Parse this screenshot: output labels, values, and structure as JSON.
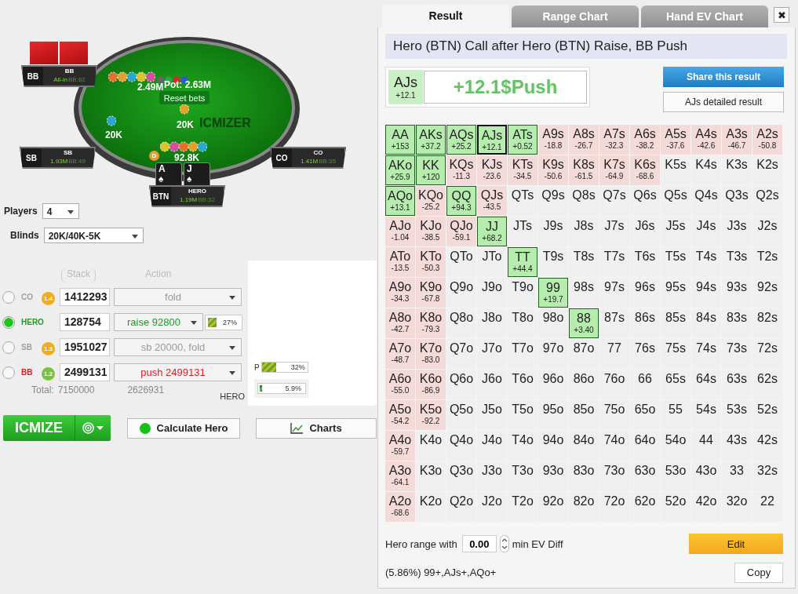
{
  "table": {
    "logo": "ICMIZER",
    "pot": "Pot: 2.63M",
    "reset": "Reset bets",
    "dealer": "D",
    "bets": [
      {
        "amount": "2.49M"
      },
      {
        "amount": "20K"
      },
      {
        "amount": "20K"
      },
      {
        "amount": "92.8K"
      }
    ],
    "seats": [
      {
        "position": "BB",
        "name": "BB",
        "stack": "All-in",
        "bb": "BB:62",
        "cards": [
          {
            "kind": "back"
          },
          {
            "kind": "back"
          }
        ]
      },
      {
        "position": "SB",
        "name": "SB",
        "stack": "1.93M",
        "bb": "BB:49"
      },
      {
        "position": "CO",
        "name": "CO",
        "stack": "1.41M",
        "bb": "BB:35"
      },
      {
        "position": "BTN",
        "name": "HERO",
        "stack": "1.19M",
        "bb": "BB:32",
        "cards": [
          {
            "kind": "face",
            "rank": "A",
            "suit": "♠"
          },
          {
            "kind": "face",
            "rank": "J",
            "suit": "♠"
          }
        ]
      }
    ]
  },
  "setup": {
    "players_label": "Players",
    "players": "4",
    "blinds_label": "Blinds",
    "blinds": "20K/40K-5K"
  },
  "players": {
    "stack_header": "Stack",
    "action_header": "Action",
    "rows": [
      {
        "position": "CO",
        "selected": false,
        "badge": "1.4",
        "color": "#f0ac1c",
        "stack": "1412293",
        "action": "fold",
        "kind": "fold"
      },
      {
        "position": "HERO",
        "selected": true,
        "stack": "128754",
        "action": "raise 92800",
        "kind": "raise",
        "range": {
          "level": 0.27,
          "reading": "27%"
        }
      },
      {
        "position": "SB",
        "selected": false,
        "badge": "1.3",
        "color": "#f0ac1c",
        "stack": "1951027",
        "action": "sb 20000, fold",
        "kind": "fold"
      },
      {
        "position": "BB",
        "selected": false,
        "badge": "1.2",
        "color": "#7cc242",
        "stack": "2499131",
        "action": "push 2499131",
        "kind": "push"
      }
    ],
    "total_label": "Total:",
    "total_stack": "7150000",
    "total_action": "2626931",
    "hero_label": "HERO",
    "p_label": "P",
    "p_bar": {
      "level": 0.32,
      "reading": "32%"
    },
    "hero_bar": {
      "level": 0.059,
      "reading": "5.9%"
    }
  },
  "buttons": {
    "icmize": "ICMIZE",
    "calculate": "Calculate Hero",
    "charts": "Charts"
  },
  "popup": {
    "tabs": [
      {
        "label": "Result",
        "selected": true
      },
      {
        "label": "Range Chart",
        "selected": false
      },
      {
        "label": "Hand EV Chart",
        "selected": false
      }
    ],
    "close": "✖",
    "title": "Hero (BTN) Call after Hero (BTN) Raise, BB Push",
    "hand": "AJs",
    "hand_ev": "+12.1",
    "result": "+12.1$Push",
    "share": "Share this result",
    "detail": "AJs detailed result",
    "grid": [
      [
        {
          "hand": "AA",
          "ev": "+153",
          "kind": "plus",
          "selected": false
        },
        {
          "hand": "AKs",
          "ev": "+37.2",
          "kind": "plus",
          "selected": false
        },
        {
          "hand": "AQs",
          "ev": "+25.2",
          "kind": "plus",
          "selected": false
        },
        {
          "hand": "AJs",
          "ev": "+12.1",
          "kind": "plus",
          "selected": true
        },
        {
          "hand": "ATs",
          "ev": "+0.52",
          "kind": "plus",
          "selected": false
        },
        {
          "hand": "A9s",
          "ev": "-18.8",
          "kind": "minus",
          "selected": false
        },
        {
          "hand": "A8s",
          "ev": "-26.7",
          "kind": "minus",
          "selected": false
        },
        {
          "hand": "A7s",
          "ev": "-32.3",
          "kind": "minus",
          "selected": false
        },
        {
          "hand": "A6s",
          "ev": "-38.2",
          "kind": "minus",
          "selected": false
        },
        {
          "hand": "A5s",
          "ev": "-37.6",
          "kind": "minus",
          "selected": false
        },
        {
          "hand": "A4s",
          "ev": "-42.6",
          "kind": "minus",
          "selected": false
        },
        {
          "hand": "A3s",
          "ev": "-46.7",
          "kind": "minus",
          "selected": false
        },
        {
          "hand": "A2s",
          "ev": "-50.8",
          "kind": "minus",
          "selected": false
        }
      ],
      [
        {
          "hand": "AKo",
          "ev": "+25.9",
          "kind": "plus",
          "selected": false
        },
        {
          "hand": "KK",
          "ev": "+120",
          "kind": "plus",
          "selected": false
        },
        {
          "hand": "KQs",
          "ev": "-11.3",
          "kind": "minus",
          "selected": false
        },
        {
          "hand": "KJs",
          "ev": "-23.6",
          "kind": "minus",
          "selected": false
        },
        {
          "hand": "KTs",
          "ev": "-34.5",
          "kind": "minus",
          "selected": false
        },
        {
          "hand": "K9s",
          "ev": "-50.6",
          "kind": "minus",
          "selected": false
        },
        {
          "hand": "K8s",
          "ev": "-61.5",
          "kind": "minus",
          "selected": false
        },
        {
          "hand": "K7s",
          "ev": "-64.9",
          "kind": "minus",
          "selected": false
        },
        {
          "hand": "K6s",
          "ev": "-68.6",
          "kind": "minus",
          "selected": false
        },
        {
          "hand": "K5s",
          "kind": "plain",
          "selected": false
        },
        {
          "hand": "K4s",
          "kind": "plain",
          "selected": false
        },
        {
          "hand": "K3s",
          "kind": "plain",
          "selected": false
        },
        {
          "hand": "K2s",
          "kind": "plain",
          "selected": false
        }
      ],
      [
        {
          "hand": "AQo",
          "ev": "+13.1",
          "kind": "plus",
          "selected": false
        },
        {
          "hand": "KQo",
          "ev": "-25.2",
          "kind": "minus",
          "selected": false
        },
        {
          "hand": "QQ",
          "ev": "+94.3",
          "kind": "plus",
          "selected": false
        },
        {
          "hand": "QJs",
          "ev": "-43.5",
          "kind": "minus",
          "selected": false
        },
        {
          "hand": "QTs",
          "kind": "plain",
          "selected": false
        },
        {
          "hand": "Q9s",
          "kind": "plain",
          "selected": false
        },
        {
          "hand": "Q8s",
          "kind": "plain",
          "selected": false
        },
        {
          "hand": "Q7s",
          "kind": "plain",
          "selected": false
        },
        {
          "hand": "Q6s",
          "kind": "plain",
          "selected": false
        },
        {
          "hand": "Q5s",
          "kind": "plain",
          "selected": false
        },
        {
          "hand": "Q4s",
          "kind": "plain",
          "selected": false
        },
        {
          "hand": "Q3s",
          "kind": "plain",
          "selected": false
        },
        {
          "hand": "Q2s",
          "kind": "plain",
          "selected": false
        }
      ],
      [
        {
          "hand": "AJo",
          "ev": "-1.04",
          "kind": "minus",
          "selected": false
        },
        {
          "hand": "KJo",
          "ev": "-38.5",
          "kind": "minus",
          "selected": false
        },
        {
          "hand": "QJo",
          "ev": "-59.1",
          "kind": "minus",
          "selected": false
        },
        {
          "hand": "JJ",
          "ev": "+68.2",
          "kind": "plus",
          "selected": false
        },
        {
          "hand": "JTs",
          "kind": "plain",
          "selected": false
        },
        {
          "hand": "J9s",
          "kind": "plain",
          "selected": false
        },
        {
          "hand": "J8s",
          "kind": "plain",
          "selected": false
        },
        {
          "hand": "J7s",
          "kind": "plain",
          "selected": false
        },
        {
          "hand": "J6s",
          "kind": "plain",
          "selected": false
        },
        {
          "hand": "J5s",
          "kind": "plain",
          "selected": false
        },
        {
          "hand": "J4s",
          "kind": "plain",
          "selected": false
        },
        {
          "hand": "J3s",
          "kind": "plain",
          "selected": false
        },
        {
          "hand": "J2s",
          "kind": "plain",
          "selected": false
        }
      ],
      [
        {
          "hand": "ATo",
          "ev": "-13.5",
          "kind": "minus",
          "selected": false
        },
        {
          "hand": "KTo",
          "ev": "-50.3",
          "kind": "minus",
          "selected": false
        },
        {
          "hand": "QTo",
          "kind": "plain",
          "selected": false
        },
        {
          "hand": "JTo",
          "kind": "plain",
          "selected": false
        },
        {
          "hand": "TT",
          "ev": "+44.4",
          "kind": "plus",
          "selected": false
        },
        {
          "hand": "T9s",
          "kind": "plain",
          "selected": false
        },
        {
          "hand": "T8s",
          "kind": "plain",
          "selected": false
        },
        {
          "hand": "T7s",
          "kind": "plain",
          "selected": false
        },
        {
          "hand": "T6s",
          "kind": "plain",
          "selected": false
        },
        {
          "hand": "T5s",
          "kind": "plain",
          "selected": false
        },
        {
          "hand": "T4s",
          "kind": "plain",
          "selected": false
        },
        {
          "hand": "T3s",
          "kind": "plain",
          "selected": false
        },
        {
          "hand": "T2s",
          "kind": "plain",
          "selected": false
        }
      ],
      [
        {
          "hand": "A9o",
          "ev": "-34.3",
          "kind": "minus",
          "selected": false
        },
        {
          "hand": "K9o",
          "ev": "-67.8",
          "kind": "minus",
          "selected": false
        },
        {
          "hand": "Q9o",
          "kind": "plain",
          "selected": false
        },
        {
          "hand": "J9o",
          "kind": "plain",
          "selected": false
        },
        {
          "hand": "T9o",
          "kind": "plain",
          "selected": false
        },
        {
          "hand": "99",
          "ev": "+19.7",
          "kind": "plus",
          "selected": false
        },
        {
          "hand": "98s",
          "kind": "plain",
          "selected": false
        },
        {
          "hand": "97s",
          "kind": "plain",
          "selected": false
        },
        {
          "hand": "96s",
          "kind": "plain",
          "selected": false
        },
        {
          "hand": "95s",
          "kind": "plain",
          "selected": false
        },
        {
          "hand": "94s",
          "kind": "plain",
          "selected": false
        },
        {
          "hand": "93s",
          "kind": "plain",
          "selected": false
        },
        {
          "hand": "92s",
          "kind": "plain",
          "selected": false
        }
      ],
      [
        {
          "hand": "A8o",
          "ev": "-42.7",
          "kind": "minus",
          "selected": false
        },
        {
          "hand": "K8o",
          "ev": "-79.3",
          "kind": "minus",
          "selected": false
        },
        {
          "hand": "Q8o",
          "kind": "plain",
          "selected": false
        },
        {
          "hand": "J8o",
          "kind": "plain",
          "selected": false
        },
        {
          "hand": "T8o",
          "kind": "plain",
          "selected": false
        },
        {
          "hand": "98o",
          "kind": "plain",
          "selected": false
        },
        {
          "hand": "88",
          "ev": "+3.40",
          "kind": "plus",
          "selected": false
        },
        {
          "hand": "87s",
          "kind": "plain",
          "selected": false
        },
        {
          "hand": "86s",
          "kind": "plain",
          "selected": false
        },
        {
          "hand": "85s",
          "kind": "plain",
          "selected": false
        },
        {
          "hand": "84s",
          "kind": "plain",
          "selected": false
        },
        {
          "hand": "83s",
          "kind": "plain",
          "selected": false
        },
        {
          "hand": "82s",
          "kind": "plain",
          "selected": false
        }
      ],
      [
        {
          "hand": "A7o",
          "ev": "-48.7",
          "kind": "minus",
          "selected": false
        },
        {
          "hand": "K7o",
          "ev": "-83.0",
          "kind": "minus",
          "selected": false
        },
        {
          "hand": "Q7o",
          "kind": "plain",
          "selected": false
        },
        {
          "hand": "J7o",
          "kind": "plain",
          "selected": false
        },
        {
          "hand": "T7o",
          "kind": "plain",
          "selected": false
        },
        {
          "hand": "97o",
          "kind": "plain",
          "selected": false
        },
        {
          "hand": "87o",
          "kind": "plain",
          "selected": false
        },
        {
          "hand": "77",
          "kind": "plain",
          "selected": false
        },
        {
          "hand": "76s",
          "kind": "plain",
          "selected": false
        },
        {
          "hand": "75s",
          "kind": "plain",
          "selected": false
        },
        {
          "hand": "74s",
          "kind": "plain",
          "selected": false
        },
        {
          "hand": "73s",
          "kind": "plain",
          "selected": false
        },
        {
          "hand": "72s",
          "kind": "plain",
          "selected": false
        }
      ],
      [
        {
          "hand": "A6o",
          "ev": "-55.0",
          "kind": "minus",
          "selected": false
        },
        {
          "hand": "K6o",
          "ev": "-86.9",
          "kind": "minus",
          "selected": false
        },
        {
          "hand": "Q6o",
          "kind": "plain",
          "selected": false
        },
        {
          "hand": "J6o",
          "kind": "plain",
          "selected": false
        },
        {
          "hand": "T6o",
          "kind": "plain",
          "selected": false
        },
        {
          "hand": "96o",
          "kind": "plain",
          "selected": false
        },
        {
          "hand": "86o",
          "kind": "plain",
          "selected": false
        },
        {
          "hand": "76o",
          "kind": "plain",
          "selected": false
        },
        {
          "hand": "66",
          "kind": "plain",
          "selected": false
        },
        {
          "hand": "65s",
          "kind": "plain",
          "selected": false
        },
        {
          "hand": "64s",
          "kind": "plain",
          "selected": false
        },
        {
          "hand": "63s",
          "kind": "plain",
          "selected": false
        },
        {
          "hand": "62s",
          "kind": "plain",
          "selected": false
        }
      ],
      [
        {
          "hand": "A5o",
          "ev": "-54.2",
          "kind": "minus",
          "selected": false
        },
        {
          "hand": "K5o",
          "ev": "-92.2",
          "kind": "minus",
          "selected": false
        },
        {
          "hand": "Q5o",
          "kind": "plain",
          "selected": false
        },
        {
          "hand": "J5o",
          "kind": "plain",
          "selected": false
        },
        {
          "hand": "T5o",
          "kind": "plain",
          "selected": false
        },
        {
          "hand": "95o",
          "kind": "plain",
          "selected": false
        },
        {
          "hand": "85o",
          "kind": "plain",
          "selected": false
        },
        {
          "hand": "75o",
          "kind": "plain",
          "selected": false
        },
        {
          "hand": "65o",
          "kind": "plain",
          "selected": false
        },
        {
          "hand": "55",
          "kind": "plain",
          "selected": false
        },
        {
          "hand": "54s",
          "kind": "plain",
          "selected": false
        },
        {
          "hand": "53s",
          "kind": "plain",
          "selected": false
        },
        {
          "hand": "52s",
          "kind": "plain",
          "selected": false
        }
      ],
      [
        {
          "hand": "A4o",
          "ev": "-59.7",
          "kind": "minus",
          "selected": false
        },
        {
          "hand": "K4o",
          "kind": "plain",
          "selected": false
        },
        {
          "hand": "Q4o",
          "kind": "plain",
          "selected": false
        },
        {
          "hand": "J4o",
          "kind": "plain",
          "selected": false
        },
        {
          "hand": "T4o",
          "kind": "plain",
          "selected": false
        },
        {
          "hand": "94o",
          "kind": "plain",
          "selected": false
        },
        {
          "hand": "84o",
          "kind": "plain",
          "selected": false
        },
        {
          "hand": "74o",
          "kind": "plain",
          "selected": false
        },
        {
          "hand": "64o",
          "kind": "plain",
          "selected": false
        },
        {
          "hand": "54o",
          "kind": "plain",
          "selected": false
        },
        {
          "hand": "44",
          "kind": "plain",
          "selected": false
        },
        {
          "hand": "43s",
          "kind": "plain",
          "selected": false
        },
        {
          "hand": "42s",
          "kind": "plain",
          "selected": false
        }
      ],
      [
        {
          "hand": "A3o",
          "ev": "-64.1",
          "kind": "minus",
          "selected": false
        },
        {
          "hand": "K3o",
          "kind": "plain",
          "selected": false
        },
        {
          "hand": "Q3o",
          "kind": "plain",
          "selected": false
        },
        {
          "hand": "J3o",
          "kind": "plain",
          "selected": false
        },
        {
          "hand": "T3o",
          "kind": "plain",
          "selected": false
        },
        {
          "hand": "93o",
          "kind": "plain",
          "selected": false
        },
        {
          "hand": "83o",
          "kind": "plain",
          "selected": false
        },
        {
          "hand": "73o",
          "kind": "plain",
          "selected": false
        },
        {
          "hand": "63o",
          "kind": "plain",
          "selected": false
        },
        {
          "hand": "53o",
          "kind": "plain",
          "selected": false
        },
        {
          "hand": "43o",
          "kind": "plain",
          "selected": false
        },
        {
          "hand": "33",
          "kind": "plain",
          "selected": false
        },
        {
          "hand": "32s",
          "kind": "plain",
          "selected": false
        }
      ],
      [
        {
          "hand": "A2o",
          "ev": "-68.6",
          "kind": "minus",
          "selected": false
        },
        {
          "hand": "K2o",
          "kind": "plain",
          "selected": false
        },
        {
          "hand": "Q2o",
          "kind": "plain",
          "selected": false
        },
        {
          "hand": "J2o",
          "kind": "plain",
          "selected": false
        },
        {
          "hand": "T2o",
          "kind": "plain",
          "selected": false
        },
        {
          "hand": "92o",
          "kind": "plain",
          "selected": false
        },
        {
          "hand": "82o",
          "kind": "plain",
          "selected": false
        },
        {
          "hand": "72o",
          "kind": "plain",
          "selected": false
        },
        {
          "hand": "62o",
          "kind": "plain",
          "selected": false
        },
        {
          "hand": "52o",
          "kind": "plain",
          "selected": false
        },
        {
          "hand": "42o",
          "kind": "plain",
          "selected": false
        },
        {
          "hand": "32o",
          "kind": "plain",
          "selected": false
        },
        {
          "hand": "22",
          "kind": "plain",
          "selected": false
        }
      ]
    ],
    "range_label": "Hero range with",
    "min_ev": "0.00",
    "min_ev_label": "min EV Diff",
    "edit": "Edit",
    "range_text": "(5.86%) 99+,AJs+,AQo+",
    "copy": "Copy"
  }
}
